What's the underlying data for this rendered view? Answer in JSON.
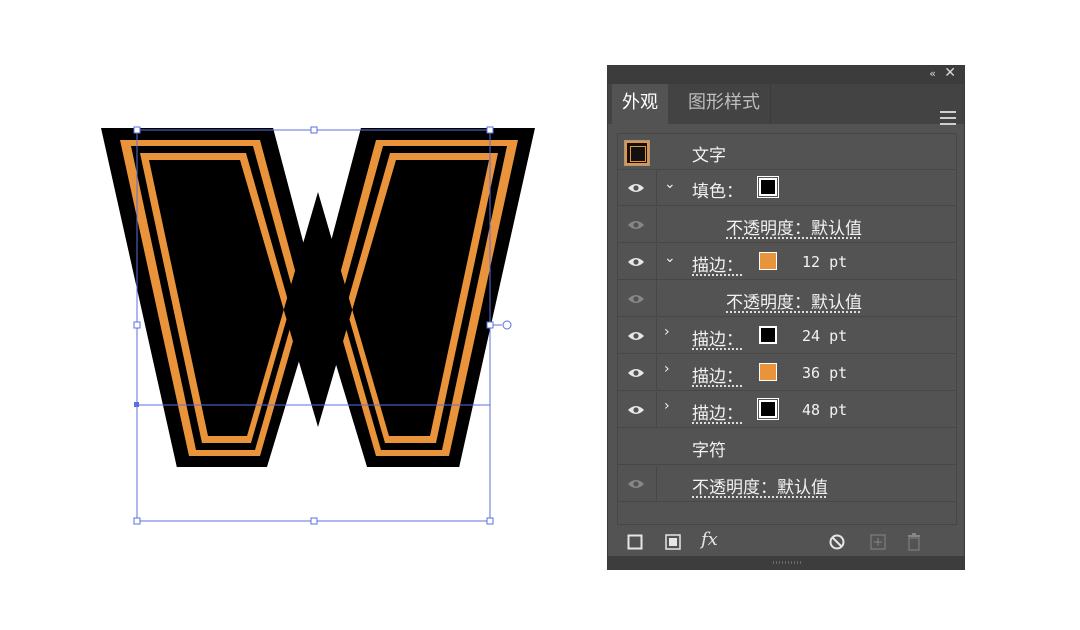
{
  "canvas": {
    "glyph": "W",
    "colors": {
      "fill": "#000000",
      "orange": "#E9933A",
      "selection": "#5B6FE0"
    }
  },
  "panel": {
    "tabs": [
      "外观",
      "图形样式"
    ],
    "collapse_icon": "«",
    "close_icon": "✕",
    "menu_icon": "hamburger-menu-icon",
    "rows": [
      {
        "label": "文字"
      },
      {
        "label": "填色："
      },
      {
        "label": "不透明度：默认值"
      },
      {
        "label": "描边：",
        "value": "12 pt"
      },
      {
        "label": "不透明度：默认值"
      },
      {
        "label": "描边：",
        "value": "24 pt"
      },
      {
        "label": "描边：",
        "value": "36 pt"
      },
      {
        "label": "描边：",
        "value": "48 pt"
      },
      {
        "label": "字符"
      },
      {
        "label": "不透明度：默认值"
      }
    ],
    "toolbar": {
      "add_stroke": "add-new-stroke-icon",
      "add_fill": "add-new-fill-icon",
      "fx": "fx",
      "clear": "clear-appearance-icon",
      "duplicate": "duplicate-item-icon",
      "delete": "trash-icon"
    }
  }
}
